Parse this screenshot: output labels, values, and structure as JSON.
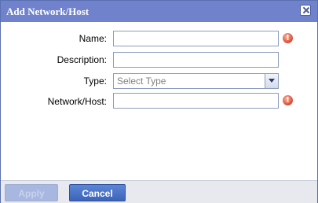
{
  "dialog": {
    "title": "Add Network/Host",
    "close_icon": "close-icon"
  },
  "form": {
    "name": {
      "label": "Name:",
      "value": "",
      "required_icon": "error-icon"
    },
    "description": {
      "label": "Description:",
      "value": ""
    },
    "type": {
      "label": "Type:",
      "selected": "Select Type",
      "arrow_icon": "chevron-down-icon"
    },
    "network_host": {
      "label": "Network/Host:",
      "value": "",
      "required_icon": "error-icon"
    }
  },
  "footer": {
    "apply_label": "Apply",
    "cancel_label": "Cancel"
  },
  "colors": {
    "titlebar": "#6f82cb",
    "accent": "#3b63b8",
    "error": "#d94a2e"
  }
}
